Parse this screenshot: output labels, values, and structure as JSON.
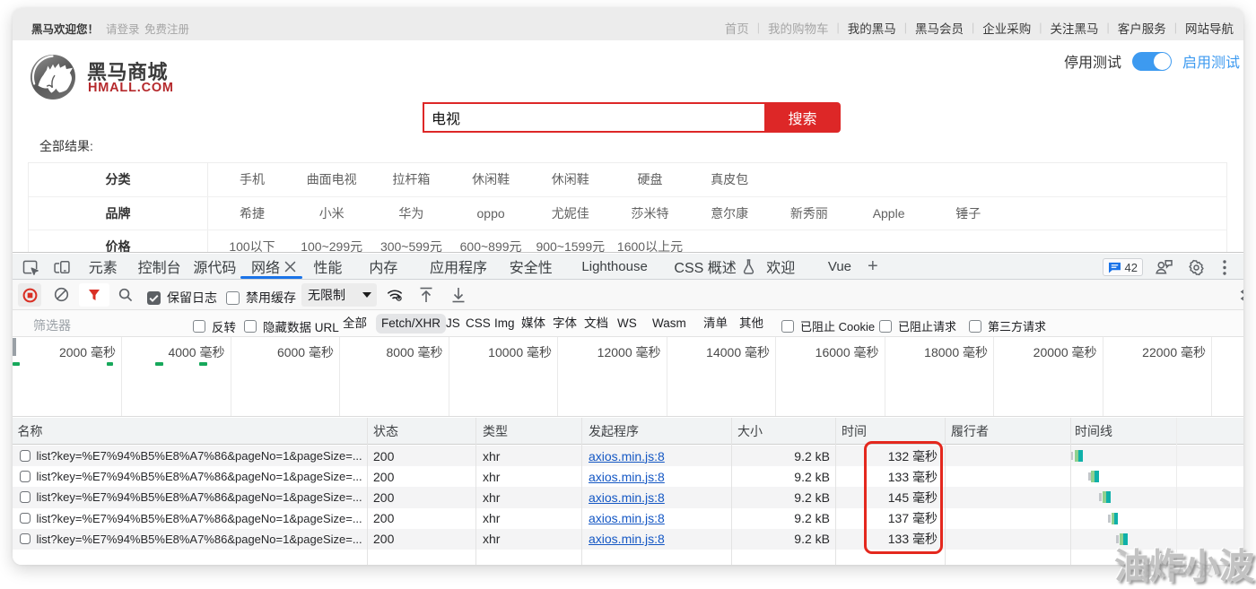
{
  "site": {
    "topbar": {
      "welcome": "黑马欢迎您！",
      "login": "请登录",
      "register": "免费注册",
      "nav": [
        {
          "label": "首页",
          "muted": true
        },
        {
          "label": "我的购物车",
          "muted": true
        },
        {
          "label": "我的黑马",
          "muted": false
        },
        {
          "label": "黑马会员",
          "muted": false
        },
        {
          "label": "企业采购",
          "muted": false
        },
        {
          "label": "关注黑马",
          "muted": false
        },
        {
          "label": "客户服务",
          "muted": false
        },
        {
          "label": "网站导航",
          "muted": false
        }
      ]
    },
    "logo": {
      "title": "黑马商城",
      "subtitle": "HMALL.COM"
    },
    "test_toggle": {
      "off_label": "停用测试",
      "on_label": "启用测试",
      "state": "on",
      "color": "#3d9af0"
    },
    "search": {
      "value": "电视",
      "button_label": "搜索",
      "accent_color": "#dd2727"
    },
    "results_label": "全部结果:",
    "category_filters": [
      {
        "label": "分类",
        "values": [
          "手机",
          "曲面电视",
          "拉杆箱",
          "休闲鞋",
          "休闲鞋",
          "硬盘",
          "真皮包"
        ]
      },
      {
        "label": "品牌",
        "values": [
          "希捷",
          "小米",
          "华为",
          "oppo",
          "尤妮佳",
          "莎米特",
          "意尔康",
          "新秀丽",
          "Apple",
          "锤子"
        ]
      },
      {
        "label": "价格",
        "values": [
          "100以下",
          "100~299元",
          "300~599元",
          "600~899元",
          "900~1599元",
          "1600以上元"
        ]
      }
    ]
  },
  "devtools": {
    "tabs": [
      {
        "label": "元素"
      },
      {
        "label": "控制台"
      },
      {
        "label": "源代码"
      },
      {
        "label": "网络",
        "active": true,
        "closable": true
      },
      {
        "label": "性能"
      },
      {
        "label": "内存"
      },
      {
        "label": "应用程序"
      },
      {
        "label": "安全性"
      },
      {
        "label": "Lighthouse",
        "latin": true
      },
      {
        "label": "CSS 概述",
        "flask": true
      },
      {
        "label": "欢迎"
      },
      {
        "label": "Vue",
        "latin": true
      }
    ],
    "more_tabs_label": "+",
    "messages_count": "42",
    "toolbar": {
      "preserve_log_label": "保留日志",
      "preserve_log_checked": true,
      "disable_cache_label": "禁用缓存",
      "disable_cache_checked": false,
      "throttling_value": "无限制"
    },
    "filter_bar": {
      "placeholder": "筛选器",
      "invert_label": "反转",
      "hide_data_urls_label": "隐藏数据 URL",
      "type_pills": [
        "全部",
        "Fetch/XHR",
        "JS",
        "CSS",
        "Img",
        "媒体",
        "字体",
        "文档",
        "WS",
        "Wasm",
        "清单",
        "其他"
      ],
      "active_pill": "Fetch/XHR",
      "blocked_cookies_label": "已阻止 Cookie",
      "blocked_requests_label": "已阻止请求",
      "third_party_label": "第三方请求"
    },
    "overview_tick_labels": [
      "2000 毫秒",
      "4000 毫秒",
      "6000 毫秒",
      "8000 毫秒",
      "10000 毫秒",
      "12000 毫秒",
      "14000 毫秒",
      "16000 毫秒",
      "18000 毫秒",
      "20000 毫秒",
      "22000 毫秒"
    ],
    "table": {
      "columns": [
        "名称",
        "状态",
        "类型",
        "发起程序",
        "大小",
        "时间",
        "履行者",
        "时间线"
      ],
      "rows": [
        {
          "name": "list?key=%E7%94%B5%E8%A7%86&pageNo=1&pageSize=...",
          "status": "200",
          "type": "xhr",
          "initiator": "axios.min.js:8",
          "size": "9.2 kB",
          "time": "132 毫秒"
        },
        {
          "name": "list?key=%E7%94%B5%E8%A7%86&pageNo=1&pageSize=...",
          "status": "200",
          "type": "xhr",
          "initiator": "axios.min.js:8",
          "size": "9.2 kB",
          "time": "133 毫秒"
        },
        {
          "name": "list?key=%E7%94%B5%E8%A7%86&pageNo=1&pageSize=...",
          "status": "200",
          "type": "xhr",
          "initiator": "axios.min.js:8",
          "size": "9.2 kB",
          "time": "145 毫秒"
        },
        {
          "name": "list?key=%E7%94%B5%E8%A7%86&pageNo=1&pageSize=...",
          "status": "200",
          "type": "xhr",
          "initiator": "axios.min.js:8",
          "size": "9.2 kB",
          "time": "137 毫秒"
        },
        {
          "name": "list?key=%E7%94%B5%E8%A7%86&pageNo=1&pageSize=...",
          "status": "200",
          "type": "xhr",
          "initiator": "axios.min.js:8",
          "size": "9.2 kB",
          "time": "133 毫秒"
        }
      ]
    }
  },
  "watermark": "油炸小波"
}
